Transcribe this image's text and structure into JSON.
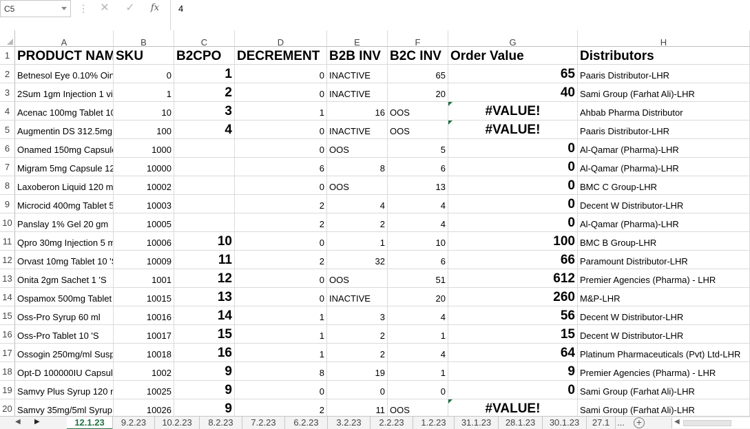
{
  "formula_bar": {
    "name_box": "C5",
    "cancel_glyph": "✕",
    "enter_glyph": "✓",
    "fx_label": "fx",
    "value": "4"
  },
  "columns": [
    "A",
    "B",
    "C",
    "D",
    "E",
    "F",
    "G",
    "H"
  ],
  "header_row": [
    "PRODUCT NAM",
    "SKU",
    "B2CPO",
    "DECREMENT",
    "B2B INV",
    "B2C INV",
    "Order Value",
    "Distributors"
  ],
  "rows": [
    {
      "n": "1"
    },
    {
      "n": "2",
      "a": "Betnesol Eye 0.10% Oin",
      "b": "0",
      "c": "1",
      "d": "0",
      "e": "INACTIVE",
      "f": "65",
      "g": "65",
      "h": "Paaris Distributor-LHR"
    },
    {
      "n": "3",
      "a": "2Sum 1gm Injection 1 vi",
      "b": "1",
      "c": "2",
      "d": "0",
      "e": "INACTIVE",
      "f": "20",
      "g": "40",
      "h": "Sami Group (Farhat Ali)-LHR"
    },
    {
      "n": "4",
      "a": "Acenac 100mg Tablet 10",
      "b": "10",
      "c": "3",
      "d": "1",
      "e": "16",
      "f": "OOS",
      "g": "#VALUE!",
      "h": "Ahbab Pharma Distributor"
    },
    {
      "n": "5",
      "a": "Augmentin DS 312.5mg",
      "b": "100",
      "c": "4",
      "d": "0",
      "e": "INACTIVE",
      "f": "OOS",
      "g": "#VALUE!",
      "h": "Paaris Distributor-LHR"
    },
    {
      "n": "6",
      "a": "Onamed 150mg Capsule",
      "b": "1000",
      "c": "",
      "d": "0",
      "e": "OOS",
      "f": "5",
      "g": "0",
      "h": "Al-Qamar (Pharma)-LHR"
    },
    {
      "n": "7",
      "a": "Migram 5mg Capsule 12",
      "b": "10000",
      "c": "",
      "d": "6",
      "e": "8",
      "f": "6",
      "g": "0",
      "h": "Al-Qamar (Pharma)-LHR"
    },
    {
      "n": "8",
      "a": "Laxoberon Liquid 120 m",
      "b": "10002",
      "c": "",
      "d": "0",
      "e": "OOS",
      "f": "13",
      "g": "0",
      "h": "BMC C Group-LHR"
    },
    {
      "n": "9",
      "a": "Microcid 400mg Tablet 5",
      "b": "10003",
      "c": "",
      "d": "2",
      "e": "4",
      "f": "4",
      "g": "0",
      "h": "Decent W Distributor-LHR"
    },
    {
      "n": "10",
      "a": "Panslay 1% Gel 20 gm",
      "b": "10005",
      "c": "",
      "d": "2",
      "e": "2",
      "f": "4",
      "g": "0",
      "h": "Al-Qamar (Pharma)-LHR"
    },
    {
      "n": "11",
      "a": "Qpro 30mg Injection 5 m",
      "b": "10006",
      "c": "10",
      "d": "0",
      "e": "1",
      "f": "10",
      "g": "100",
      "h": "BMC B Group-LHR"
    },
    {
      "n": "12",
      "a": "Orvast 10mg Tablet 10 'S",
      "b": "10009",
      "c": "11",
      "d": "2",
      "e": "32",
      "f": "6",
      "g": "66",
      "h": "Paramount Distributor-LHR"
    },
    {
      "n": "13",
      "a": "Onita 2gm Sachet 1 'S",
      "b": "1001",
      "c": "12",
      "d": "0",
      "e": "OOS",
      "f": "51",
      "g": "612",
      "h": "Premier Agencies (Pharma) - LHR"
    },
    {
      "n": "14",
      "a": "Ospamox 500mg Tablet",
      "b": "10015",
      "c": "13",
      "d": "0",
      "e": "INACTIVE",
      "f": "20",
      "g": "260",
      "h": "M&P-LHR"
    },
    {
      "n": "15",
      "a": "Oss-Pro Syrup 60 ml",
      "b": "10016",
      "c": "14",
      "d": "1",
      "e": "3",
      "f": "4",
      "g": "56",
      "h": "Decent W Distributor-LHR"
    },
    {
      "n": "16",
      "a": "Oss-Pro Tablet 10 'S",
      "b": "10017",
      "c": "15",
      "d": "1",
      "e": "2",
      "f": "1",
      "g": "15",
      "h": "Decent W Distributor-LHR"
    },
    {
      "n": "17",
      "a": "Ossogin 250mg/ml Susp",
      "b": "10018",
      "c": "16",
      "d": "1",
      "e": "2",
      "f": "4",
      "g": "64",
      "h": "Platinum Pharmaceuticals (Pvt) Ltd-LHR"
    },
    {
      "n": "18",
      "a": "Opt-D 100000IU Capsule",
      "b": "1002",
      "c": "9",
      "d": "8",
      "e": "19",
      "f": "1",
      "g": "9",
      "h": "Premier Agencies (Pharma) - LHR"
    },
    {
      "n": "19",
      "a": "Samvy Plus Syrup 120 m",
      "b": "10025",
      "c": "9",
      "d": "0",
      "e": "0",
      "f": "0",
      "g": "0",
      "h": "Sami Group (Farhat Ali)-LHR"
    },
    {
      "n": "20",
      "a": "Samvy 35mg/5ml Syrup",
      "b": "10026",
      "c": "9",
      "d": "2",
      "e": "11",
      "f": "OOS",
      "g": "#VALUE!",
      "h": "Sami Group (Farhat Ali)-LHR"
    }
  ],
  "sheet_tabs": [
    "12.1.23",
    "9.2.23",
    "10.2.23",
    "8.2.23",
    "7.2.23",
    "6.2.23",
    "3.2.23",
    "2.2.23",
    "1.2.23",
    "31.1.23",
    "28.1.23",
    "30.1.23",
    "27.1"
  ],
  "more_tabs": "...",
  "add_sheet": "+",
  "colors": {
    "active_tab": "#217346",
    "error_indicator": "#1e7145"
  }
}
